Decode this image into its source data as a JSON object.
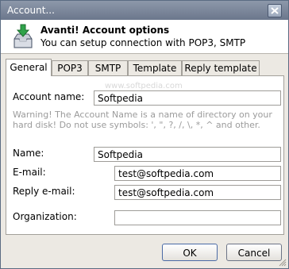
{
  "window": {
    "title": "Account..."
  },
  "header": {
    "title": "Avanti! Account options",
    "subtitle": "You can setup connection with POP3, SMTP"
  },
  "tabs": [
    {
      "label": "General",
      "active": true
    },
    {
      "label": "POP3",
      "active": false
    },
    {
      "label": "SMTP",
      "active": false
    },
    {
      "label": "Template",
      "active": false
    },
    {
      "label": "Reply template",
      "active": false
    }
  ],
  "general": {
    "watermark": "www.softpedia.com",
    "account_name_label": "Account name:",
    "account_name_value": "Softpedia",
    "warning": "Warning! The Account Name is a name of directory on your hard disk! Do not use symbols: ', \", ?, /, \\, *, ^ and other.",
    "name_label": "Name:",
    "name_value": "Softpedia",
    "email_label": "E-mail:",
    "email_value": "test@softpedia.com",
    "reply_email_label": "Reply e-mail:",
    "reply_email_value": "test@softpedia.com",
    "organization_label": "Organization:",
    "organization_value": ""
  },
  "buttons": {
    "ok": "OK",
    "cancel": "Cancel"
  }
}
